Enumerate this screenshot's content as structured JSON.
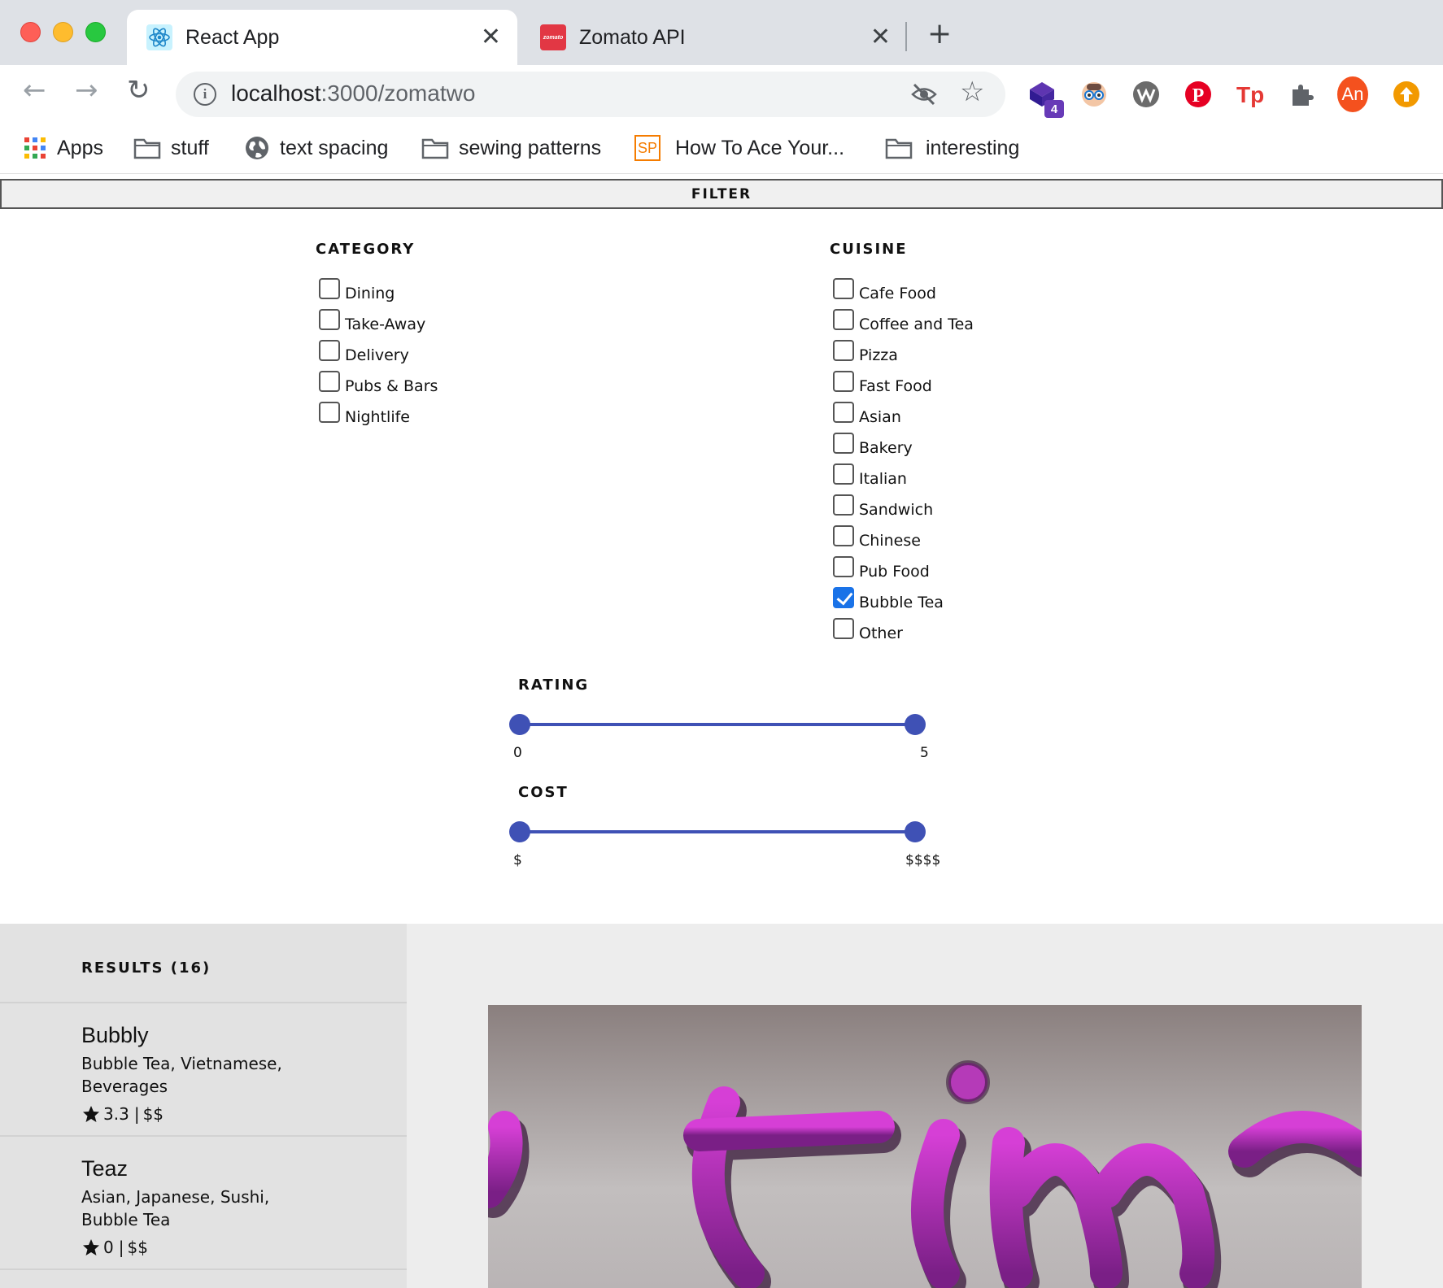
{
  "browser": {
    "tabs": [
      {
        "title": "React App",
        "active": true,
        "favicon": "react-logo-icon"
      },
      {
        "title": "Zomato API",
        "active": false,
        "favicon": "zomato-logo-icon",
        "favicon_text": "zomato"
      }
    ],
    "url_host": "localhost",
    "url_rest": ":3000/zomatwo",
    "extension_badge": "4",
    "profile_initials": "An",
    "bookmarks": [
      {
        "label": "Apps",
        "icon": "apps-grid-icon"
      },
      {
        "label": "stuff",
        "icon": "folder-icon"
      },
      {
        "label": "text spacing",
        "icon": "globe-icon"
      },
      {
        "label": "sewing patterns",
        "icon": "folder-icon"
      },
      {
        "label": "How To Ace Your...",
        "icon": "sp-logo-icon",
        "icon_text": "SP"
      },
      {
        "label": "interesting",
        "icon": "folder-icon"
      }
    ]
  },
  "filter": {
    "toggle_label": "FILTER",
    "category": {
      "title": "CATEGORY",
      "options": [
        {
          "label": "Dining",
          "checked": false
        },
        {
          "label": "Take-Away",
          "checked": false
        },
        {
          "label": "Delivery",
          "checked": false
        },
        {
          "label": "Pubs & Bars",
          "checked": false
        },
        {
          "label": "Nightlife",
          "checked": false
        }
      ]
    },
    "cuisine": {
      "title": "CUISINE",
      "options": [
        {
          "label": "Cafe Food",
          "checked": false
        },
        {
          "label": "Coffee and Tea",
          "checked": false
        },
        {
          "label": "Pizza",
          "checked": false
        },
        {
          "label": "Fast Food",
          "checked": false
        },
        {
          "label": "Asian",
          "checked": false
        },
        {
          "label": "Bakery",
          "checked": false
        },
        {
          "label": "Italian",
          "checked": false
        },
        {
          "label": "Sandwich",
          "checked": false
        },
        {
          "label": "Chinese",
          "checked": false
        },
        {
          "label": "Pub Food",
          "checked": false
        },
        {
          "label": "Bubble Tea",
          "checked": true
        },
        {
          "label": "Other",
          "checked": false
        }
      ]
    },
    "rating": {
      "title": "RATING",
      "min_label": "0",
      "max_label": "5",
      "low": 0,
      "high": 5
    },
    "cost": {
      "title": "COST",
      "min_label": "$",
      "max_label": "$$$$",
      "low": 1,
      "high": 4
    }
  },
  "results": {
    "title": "RESULTS (16)",
    "items": [
      {
        "name": "Bubbly",
        "cuisine": "Bubble Tea, Vietnamese, Beverages",
        "rating": "3.3",
        "cost": "$$"
      },
      {
        "name": "Teaz",
        "cuisine": "Asian, Japanese, Sushi, Bubble Tea",
        "rating": "0",
        "cost": "$$"
      }
    ]
  },
  "colors": {
    "slider": "#3f51b5",
    "checkbox_checked": "#1a73e8",
    "results_panel": "#e2e2e2",
    "results_bg": "#ededed"
  }
}
